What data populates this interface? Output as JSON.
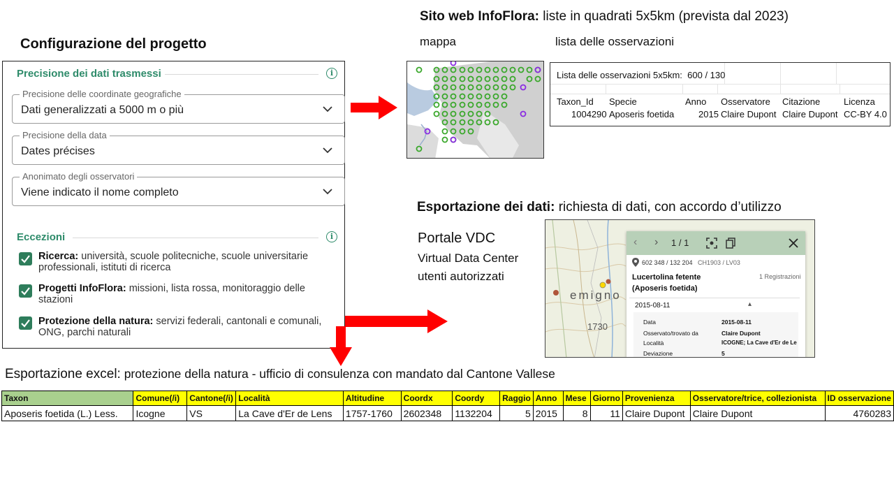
{
  "config": {
    "heading": "Configurazione del progetto",
    "precision_section": "Precisione dei dati trasmessi",
    "fields": [
      {
        "label": "Precisione delle coordinate geografiche",
        "value": "Dati generalizzati a 5000 m o più"
      },
      {
        "label": "Precisione della data",
        "value": "Dates précises"
      },
      {
        "label": "Anonimato degli osservatori",
        "value": "Viene indicato il nome completo"
      }
    ],
    "exceptions_section": "Eccezioni",
    "exceptions": [
      {
        "bold": "Ricerca:",
        "text": " università, scuole politecniche, scuole universitarie professionali, istituti di ricerca",
        "checked": true
      },
      {
        "bold": "Progetti InfoFlora:",
        "text": " missioni, lista rossa, monitoraggio delle stazioni",
        "checked": true
      },
      {
        "bold": "Protezione della natura:",
        "text": " servizi federali, cantonali e comunali, ONG, parchi naturali",
        "checked": true
      }
    ]
  },
  "website": {
    "title_bold": "Sito web InfoFlora:",
    "title_rest": " liste in quadrati 5x5km (prevista dal 2023)",
    "map_label": "mappa",
    "list_label": "lista delle osservazioni"
  },
  "obs_list": {
    "title": "Lista delle osservazioni 5x5km:  600 / 130",
    "headers": [
      "Taxon_Id",
      "Specie",
      "Anno",
      "Osservatore",
      "Citazione",
      "Licenza"
    ],
    "row": [
      "1004290",
      "Aposeris foetida",
      "2015",
      "Claire Dupont",
      "Claire Dupont",
      "CC-BY 4.0"
    ]
  },
  "export": {
    "title_bold": "Esportazione dei dati:",
    "title_rest": " richiesta di dati, con accordo d’utilizzo",
    "portal": "Portale VDC",
    "portal_sub1": "Virtual Data Center",
    "portal_sub2": "utenti autorizzati"
  },
  "vdc": {
    "pager": "1 / 1",
    "coords": "602 348 / 132 204",
    "ref": "CH1903 / LV03",
    "name": "Lucertolina fetente",
    "latin": "(Aposeris foetida)",
    "registrations": "1 Registrazioni",
    "date_toggle": "2015-08-11",
    "map_text_1": "emigno",
    "map_text_2": "1730",
    "details": [
      {
        "k": "Data",
        "v": "2015-08-11"
      },
      {
        "k": "Osservato/trovato da",
        "v": "Claire Dupont"
      },
      {
        "k": "Località",
        "v": "ICOGNE; La Cave d'Er de Le"
      },
      {
        "k": "Deviazione",
        "v": "5"
      }
    ]
  },
  "excel": {
    "title_bold": "Esportazione excel:",
    "title_rest": " protezione della natura - ufficio di consulenza con mandato dal Cantone Vallese",
    "headers": [
      "Taxon",
      "Comune(/i)",
      "Cantone(/i)",
      "Località",
      "Altitudine",
      "Coordx",
      "Coordy",
      "Raggio",
      "Anno",
      "Mese",
      "Giorno",
      "Provenienza",
      "Osservatore/trice, collezionista",
      "ID osservazione"
    ],
    "row": [
      "Aposeris foetida (L.) Less.",
      "Icogne",
      "VS",
      "La Cave d'Er de Lens",
      "1757-1760",
      "2602348",
      "1132204",
      "5",
      "2015",
      "8",
      "11",
      "Claire Dupont",
      "Claire Dupont",
      "4760283"
    ]
  },
  "colors": {
    "accent": "#2e8b6a",
    "checkbox": "#2e7d5b",
    "arrow": "#ff0000",
    "excel_header": "#ffff00",
    "excel_taxon_header": "#a9d08e"
  }
}
